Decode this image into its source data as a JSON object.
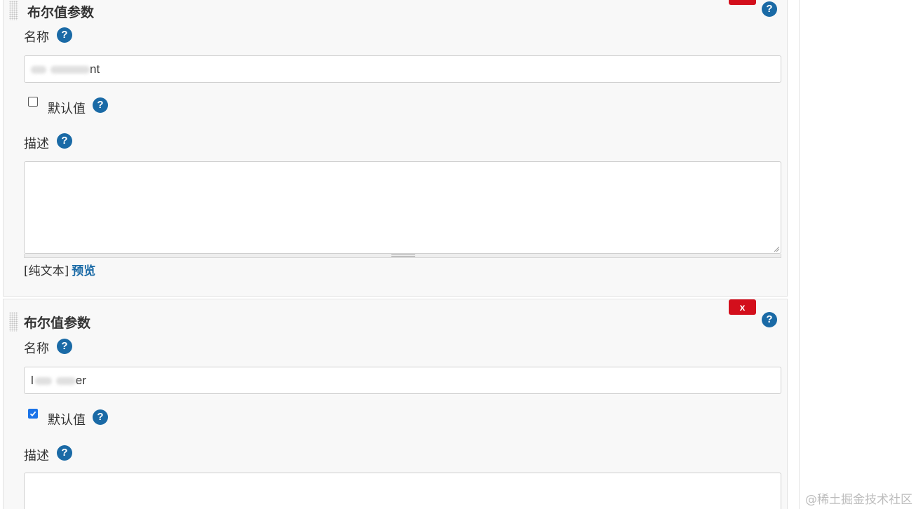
{
  "blocks": [
    {
      "title": "布尔值参数",
      "delete_label": "",
      "name_label": "名称",
      "name_value_prefix": "",
      "name_value_suffix": "nt",
      "default_label": "默认值",
      "default_checked": false,
      "description_label": "描述",
      "description_value": "",
      "format_plain": "[纯文本]",
      "format_preview": "预览"
    },
    {
      "title": "布尔值参数",
      "delete_label": "x",
      "name_label": "名称",
      "name_value_prefix": "l",
      "name_value_suffix": "er",
      "default_label": "默认值",
      "default_checked": true,
      "description_label": "描述",
      "description_value": ""
    }
  ],
  "help_glyph": "?",
  "watermark": "@稀土掘金技术社区",
  "colors": {
    "help": "#1a6aa6",
    "delete": "#d30f1c",
    "checkbox_checked": "#1a73e8",
    "panel_bg": "#f8f8f8"
  },
  "icons": [
    "drag-handle-icon",
    "help-icon",
    "checkmark-icon",
    "resize-grip-icon"
  ]
}
